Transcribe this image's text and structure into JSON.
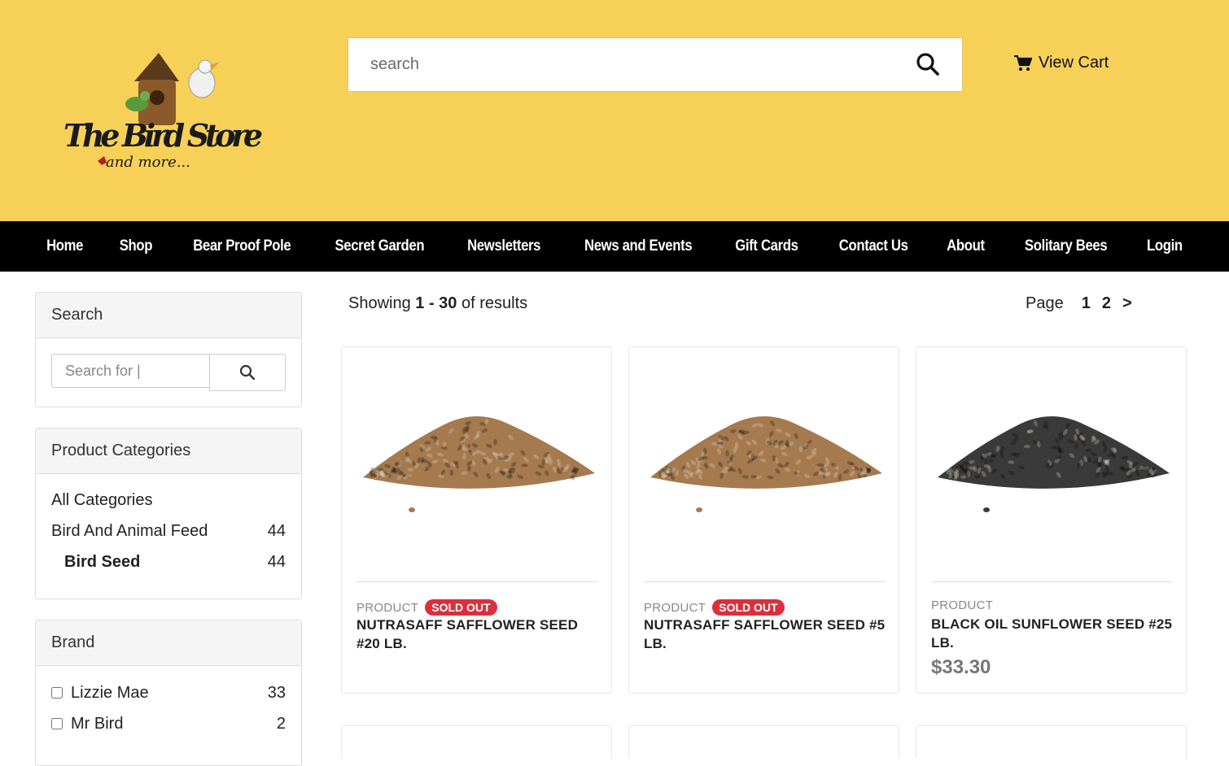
{
  "header": {
    "logo_alt": "The Bird Store and more...",
    "search_placeholder": "search",
    "cart_label": "View Cart"
  },
  "nav": {
    "items": [
      "Home",
      "Shop",
      "Bear Proof Pole",
      "Secret Garden",
      "Newsletters",
      "News and Events",
      "Gift Cards",
      "Contact Us",
      "About",
      "Solitary Bees",
      "Login"
    ]
  },
  "sidebar": {
    "search": {
      "title": "Search",
      "placeholder": "Search for |"
    },
    "categories": {
      "title": "Product Categories",
      "all": "All Categories",
      "items": [
        {
          "label": "Bird And Animal Feed",
          "count": "44"
        },
        {
          "label": "Bird Seed",
          "count": "44"
        }
      ]
    },
    "brand": {
      "title": "Brand",
      "items": [
        {
          "label": "Lizzie Mae",
          "count": "33"
        },
        {
          "label": "Mr Bird",
          "count": "2"
        }
      ]
    }
  },
  "results": {
    "showing_prefix": "Showing",
    "range": "1 - 30",
    "showing_suffix": "of results",
    "page_label": "Page",
    "pages": [
      "1",
      "2",
      ">"
    ]
  },
  "products": [
    {
      "type": "PRODUCT",
      "badge": "SOLD OUT",
      "title": "NUTRASAFF SAFFLOWER SEED #20 LB.",
      "price": "",
      "seed_color": "#a57a4e"
    },
    {
      "type": "PRODUCT",
      "badge": "SOLD OUT",
      "title": "NUTRASAFF SAFFLOWER SEED #5 LB.",
      "price": "",
      "seed_color": "#a57a4e"
    },
    {
      "type": "PRODUCT",
      "badge": "",
      "title": "BLACK OIL SUNFLOWER SEED #25 LB.",
      "price": "$33.30",
      "seed_color": "#3a3a3a"
    }
  ],
  "colors": {
    "header_bg": "#f7d057",
    "nav_bg": "#000000",
    "badge": "#dc2f3d"
  }
}
